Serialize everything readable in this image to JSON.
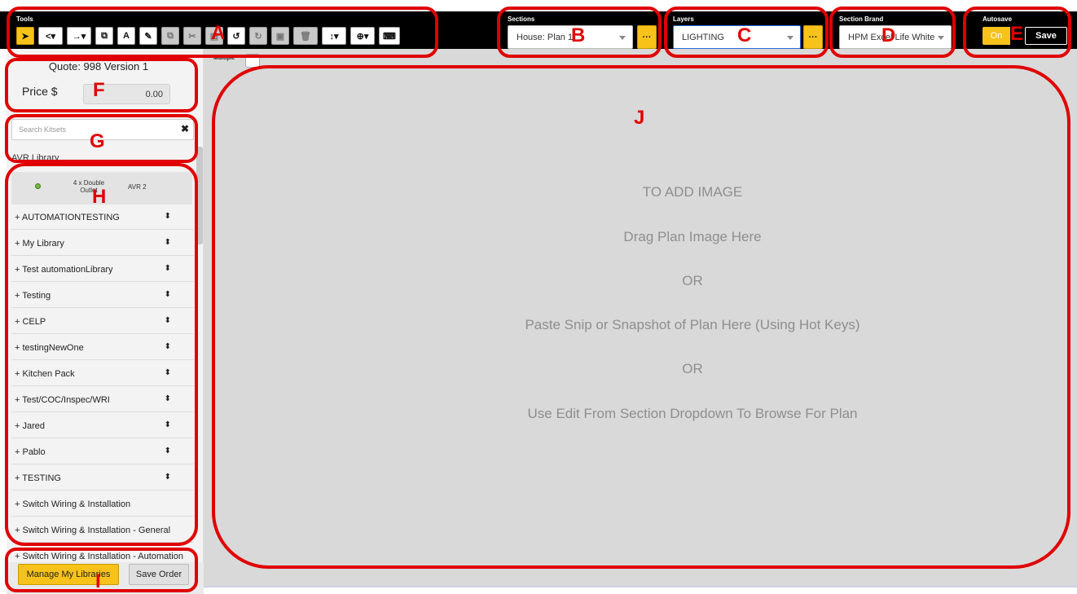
{
  "toolbar": {
    "tools_title": "Tools",
    "buttons": [
      {
        "icon": "pointer-icon",
        "glyph": "➤",
        "state": "active"
      },
      {
        "icon": "share-icon",
        "glyph": "<▾",
        "state": "normal"
      },
      {
        "icon": "arrow-right-icon",
        "glyph": "→▾",
        "state": "normal"
      },
      {
        "icon": "copy-icon",
        "glyph": "⧉",
        "state": "normal"
      },
      {
        "icon": "text-icon",
        "glyph": "A",
        "state": "normal"
      },
      {
        "icon": "edit-icon",
        "glyph": "✎",
        "state": "normal"
      },
      {
        "icon": "duplicate-icon",
        "glyph": "⧉",
        "state": "disabled"
      },
      {
        "icon": "cut-icon",
        "glyph": "✂",
        "state": "disabled"
      },
      {
        "icon": "paste-icon",
        "glyph": "▤",
        "state": "disabled"
      },
      {
        "icon": "undo-icon",
        "glyph": "↺",
        "state": "normal"
      },
      {
        "icon": "redo-icon",
        "glyph": "↻",
        "state": "disabled"
      },
      {
        "icon": "image-icon",
        "glyph": "▣",
        "state": "disabled"
      },
      {
        "icon": "delete-icon",
        "glyph": "🗑",
        "state": "disabled"
      },
      {
        "icon": "height-icon",
        "glyph": "↕▾",
        "state": "normal"
      },
      {
        "icon": "zoom-icon",
        "glyph": "⊕▾",
        "state": "normal"
      },
      {
        "icon": "keyboard-icon",
        "glyph": "⌨",
        "state": "normal"
      }
    ]
  },
  "sections": {
    "title": "Sections",
    "value": "House: Plan 1",
    "more": "···"
  },
  "layers": {
    "title": "Layers",
    "value": "LIGHTING",
    "more": "···"
  },
  "section_brand": {
    "title": "Section Brand",
    "value": "HPM Excel Life White"
  },
  "autosave": {
    "title": "Autosave",
    "on_label": "On",
    "save_label": "Save"
  },
  "sidebar": {
    "quote_title": "Quote: 998 Version 1",
    "price_label": "Price $",
    "price_value": "0.00",
    "search_placeholder": "Search Kitsets",
    "clear_glyph": "✖",
    "avr_library": "AVR Library",
    "kit": {
      "name": "4 x Double Outlet",
      "code": "AVR 2"
    },
    "libraries": [
      {
        "label": "+ AUTOMATIONTESTING",
        "sortable": true
      },
      {
        "label": "+ My Library",
        "sortable": true
      },
      {
        "label": "+ Test automationLibrary",
        "sortable": true
      },
      {
        "label": "+ Testing",
        "sortable": true
      },
      {
        "label": "+ CELP",
        "sortable": true
      },
      {
        "label": "+ testingNewOne",
        "sortable": true
      },
      {
        "label": "+ Kitchen Pack",
        "sortable": true
      },
      {
        "label": "+ Test/COC/Inspec/WRI",
        "sortable": true
      },
      {
        "label": "+ Jared",
        "sortable": true
      },
      {
        "label": "+ Pablo",
        "sortable": true
      },
      {
        "label": "+ TESTING",
        "sortable": true
      },
      {
        "label": "+ Switch Wiring & Installation",
        "sortable": false
      },
      {
        "label": "+ Switch Wiring & Installation - General",
        "sortable": false
      },
      {
        "label": "+ Switch Wiring & Installation - Automation",
        "sortable": false
      }
    ],
    "sort_glyph": "⬍",
    "manage_label": "Manage My Libraries",
    "save_order_label": "Save Order"
  },
  "main": {
    "multiple_label": "Multiple",
    "drop_lines": [
      "TO ADD IMAGE",
      "Drag Plan Image Here",
      "OR",
      "Paste Snip or Snapshot of Plan Here (Using Hot Keys)",
      "OR",
      "Use Edit From Section Dropdown To Browse For Plan"
    ]
  },
  "annotations": [
    "A",
    "B",
    "C",
    "D",
    "E",
    "F",
    "G",
    "H",
    "I",
    "J"
  ],
  "colors": {
    "accent": "#f7c21a",
    "annotation": "#e00000",
    "canvas": "#d9d9d9"
  }
}
